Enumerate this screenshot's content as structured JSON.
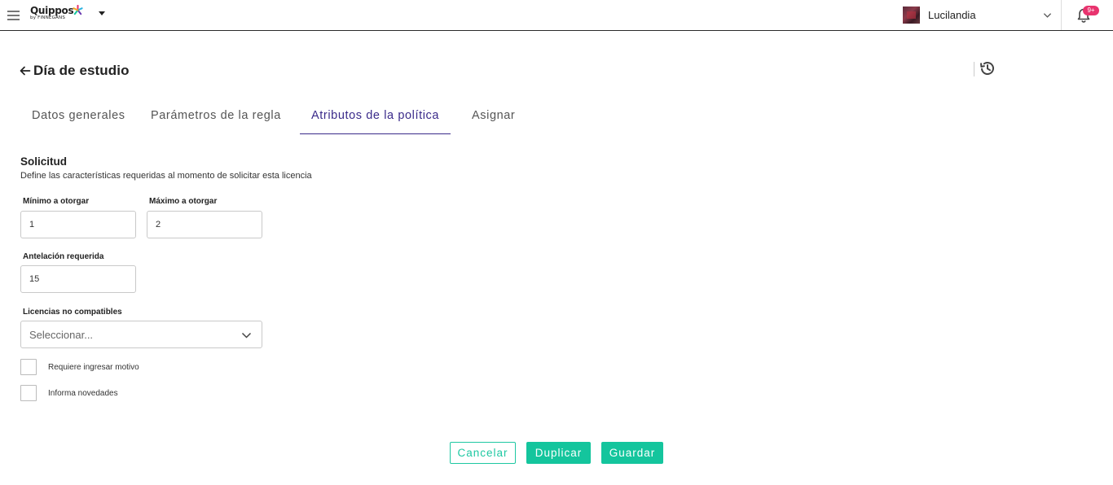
{
  "app": {
    "logo_text": "Quippos",
    "logo_sub": "by FINNEGANS",
    "company_name": "Lucilandia",
    "notifications_badge": "9+"
  },
  "header": {
    "title": "Día de estudio"
  },
  "tabs": [
    {
      "label": "Datos generales",
      "active": false
    },
    {
      "label": "Parámetros de la regla",
      "active": false
    },
    {
      "label": "Atributos de la política",
      "active": true
    },
    {
      "label": "Asignar",
      "active": false
    }
  ],
  "section": {
    "title": "Solicitud",
    "description": "Define las características requeridas al momento de solicitar esta licencia"
  },
  "fields": {
    "min": {
      "label": "Mínimo a otorgar",
      "value": "1"
    },
    "max": {
      "label": "Máximo a otorgar",
      "value": "2"
    },
    "anticipation": {
      "label": "Antelación requerida",
      "value": "15"
    },
    "incompatible": {
      "label": "Licencias no compatibles",
      "placeholder": "Seleccionar..."
    }
  },
  "checkboxes": [
    {
      "label": "Requiere ingresar motivo",
      "checked": false
    },
    {
      "label": "Informa novedades",
      "checked": false
    }
  ],
  "buttons": {
    "cancel": "Cancelar",
    "duplicate": "Duplicar",
    "save": "Guardar"
  },
  "colors": {
    "accent": "#14c59d",
    "tab_active": "#3a2a8a",
    "badge": "#e8336e"
  }
}
